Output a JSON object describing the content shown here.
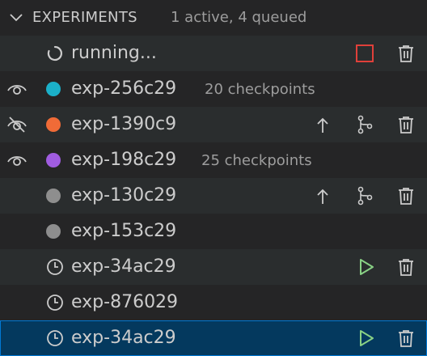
{
  "header": {
    "title": "EXPERIMENTS",
    "description": "1 active, 4 queued"
  },
  "colors": {
    "teal": "#1bb0c9",
    "orange": "#f06b37",
    "purple": "#a05ce0",
    "gray": "#8e8e8e",
    "stop_red": "#e0403a",
    "play_green": "#89d185",
    "selection": "#04395e"
  },
  "rows": [
    {
      "label": "running...",
      "icon": "spinner-icon",
      "actions": [
        "stop-icon",
        "trash-icon"
      ]
    },
    {
      "label": "exp-256c29",
      "sublabel": "20 checkpoints",
      "icon": "teal-dot",
      "visibility": "eye-icon"
    },
    {
      "label": "exp-1390c9",
      "icon": "orange-dot",
      "visibility": "eye-closed-icon",
      "actions": [
        "push-icon",
        "branch-icon",
        "trash-icon"
      ]
    },
    {
      "label": "exp-198c29",
      "sublabel": "25 checkpoints",
      "icon": "purple-dot",
      "visibility": "eye-icon"
    },
    {
      "label": "exp-130c29",
      "icon": "gray-dot",
      "actions": [
        "push-icon",
        "branch-icon",
        "trash-icon"
      ]
    },
    {
      "label": "exp-153c29",
      "icon": "gray-dot"
    },
    {
      "label": "exp-34ac29",
      "icon": "clock-icon",
      "actions": [
        "play-icon",
        "trash-icon"
      ]
    },
    {
      "label": "exp-876029",
      "icon": "clock-icon"
    },
    {
      "label": "exp-34ac29",
      "icon": "clock-icon",
      "actions": [
        "play-icon",
        "trash-icon"
      ],
      "selected": true
    }
  ]
}
